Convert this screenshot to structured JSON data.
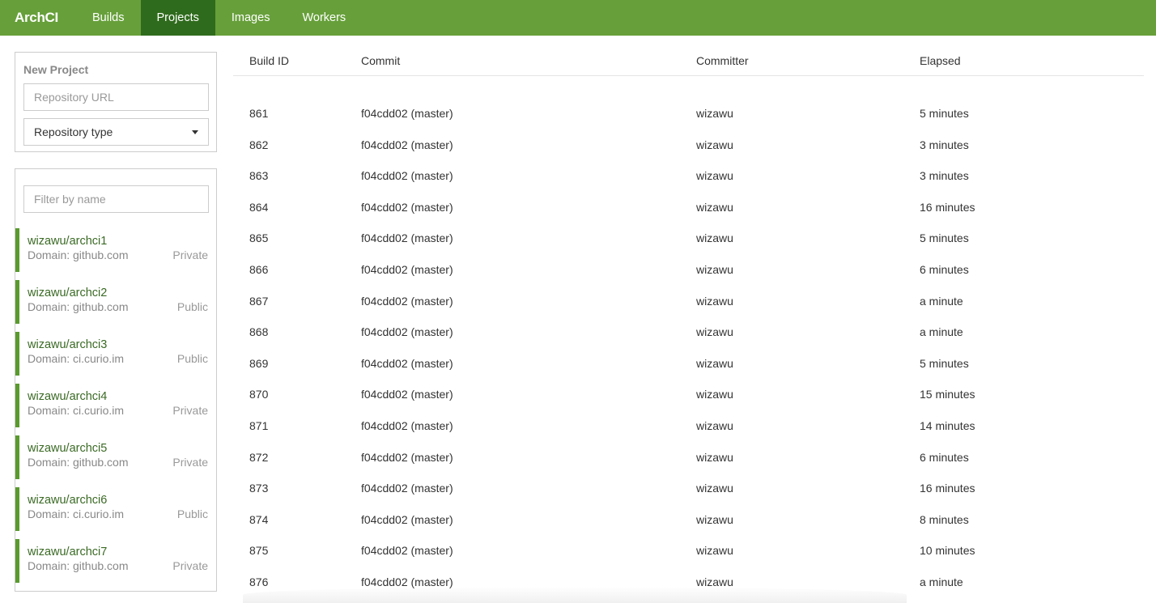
{
  "navbar": {
    "brand": "ArchCI",
    "items": [
      {
        "label": "Builds"
      },
      {
        "label": "Projects"
      },
      {
        "label": "Images"
      },
      {
        "label": "Workers"
      }
    ],
    "active": "Projects",
    "color": "#67a03a",
    "active_color": "#2f6b1c"
  },
  "new_project": {
    "title": "New Project",
    "url_placeholder": "Repository URL",
    "type_label": "Repository type"
  },
  "project_list": {
    "filter_placeholder": "Filter by name",
    "items": [
      {
        "name": "wizawu/archci1",
        "domain": "Domain: github.com",
        "visibility": "Private"
      },
      {
        "name": "wizawu/archci2",
        "domain": "Domain: github.com",
        "visibility": "Public"
      },
      {
        "name": "wizawu/archci3",
        "domain": "Domain: ci.curio.im",
        "visibility": "Public"
      },
      {
        "name": "wizawu/archci4",
        "domain": "Domain: ci.curio.im",
        "visibility": "Private"
      },
      {
        "name": "wizawu/archci5",
        "domain": "Domain: github.com",
        "visibility": "Private"
      },
      {
        "name": "wizawu/archci6",
        "domain": "Domain: ci.curio.im",
        "visibility": "Public"
      },
      {
        "name": "wizawu/archci7",
        "domain": "Domain: github.com",
        "visibility": "Private"
      }
    ]
  },
  "builds": {
    "columns": [
      "Build ID",
      "Commit",
      "Committer",
      "Elapsed"
    ],
    "rows": [
      {
        "id": "861",
        "commit": "f04cdd02 (master)",
        "committer": "wizawu",
        "elapsed": "5 minutes"
      },
      {
        "id": "862",
        "commit": "f04cdd02 (master)",
        "committer": "wizawu",
        "elapsed": "3 minutes"
      },
      {
        "id": "863",
        "commit": "f04cdd02 (master)",
        "committer": "wizawu",
        "elapsed": "3 minutes"
      },
      {
        "id": "864",
        "commit": "f04cdd02 (master)",
        "committer": "wizawu",
        "elapsed": "16 minutes"
      },
      {
        "id": "865",
        "commit": "f04cdd02 (master)",
        "committer": "wizawu",
        "elapsed": "5 minutes"
      },
      {
        "id": "866",
        "commit": "f04cdd02 (master)",
        "committer": "wizawu",
        "elapsed": "6 minutes"
      },
      {
        "id": "867",
        "commit": "f04cdd02 (master)",
        "committer": "wizawu",
        "elapsed": "a minute"
      },
      {
        "id": "868",
        "commit": "f04cdd02 (master)",
        "committer": "wizawu",
        "elapsed": "a minute"
      },
      {
        "id": "869",
        "commit": "f04cdd02 (master)",
        "committer": "wizawu",
        "elapsed": "5 minutes"
      },
      {
        "id": "870",
        "commit": "f04cdd02 (master)",
        "committer": "wizawu",
        "elapsed": "15 minutes"
      },
      {
        "id": "871",
        "commit": "f04cdd02 (master)",
        "committer": "wizawu",
        "elapsed": "14 minutes"
      },
      {
        "id": "872",
        "commit": "f04cdd02 (master)",
        "committer": "wizawu",
        "elapsed": "6 minutes"
      },
      {
        "id": "873",
        "commit": "f04cdd02 (master)",
        "committer": "wizawu",
        "elapsed": "16 minutes"
      },
      {
        "id": "874",
        "commit": "f04cdd02 (master)",
        "committer": "wizawu",
        "elapsed": "8 minutes"
      },
      {
        "id": "875",
        "commit": "f04cdd02 (master)",
        "committer": "wizawu",
        "elapsed": "10 minutes"
      },
      {
        "id": "876",
        "commit": "f04cdd02 (master)",
        "committer": "wizawu",
        "elapsed": "a minute"
      }
    ]
  }
}
